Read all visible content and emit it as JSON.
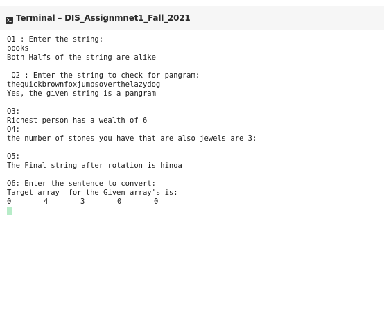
{
  "window": {
    "title": "Terminal – DIS_Assignmnet1_Fall_2021"
  },
  "terminal": {
    "lines": [
      "Q1 : Enter the string:",
      "books",
      "Both Halfs of the string are alike",
      "",
      " Q2 : Enter the string to check for pangram:",
      "thequickbrownfoxjumpsoverthelazydog",
      "Yes, the given string is a pangram",
      "",
      "Q3:",
      "Richest person has a wealth of 6",
      "Q4:",
      "the number of stones you have that are also jewels are 3:",
      "",
      "Q5:",
      "The Final string after rotation is hinoa",
      "",
      "Q6: Enter the sentence to convert:",
      "Target array  for the Given array's is:"
    ],
    "array_values": [
      "0",
      "4",
      "3",
      "0",
      "0"
    ]
  },
  "icons": {
    "title_icon": "terminal-prompt-icon"
  }
}
